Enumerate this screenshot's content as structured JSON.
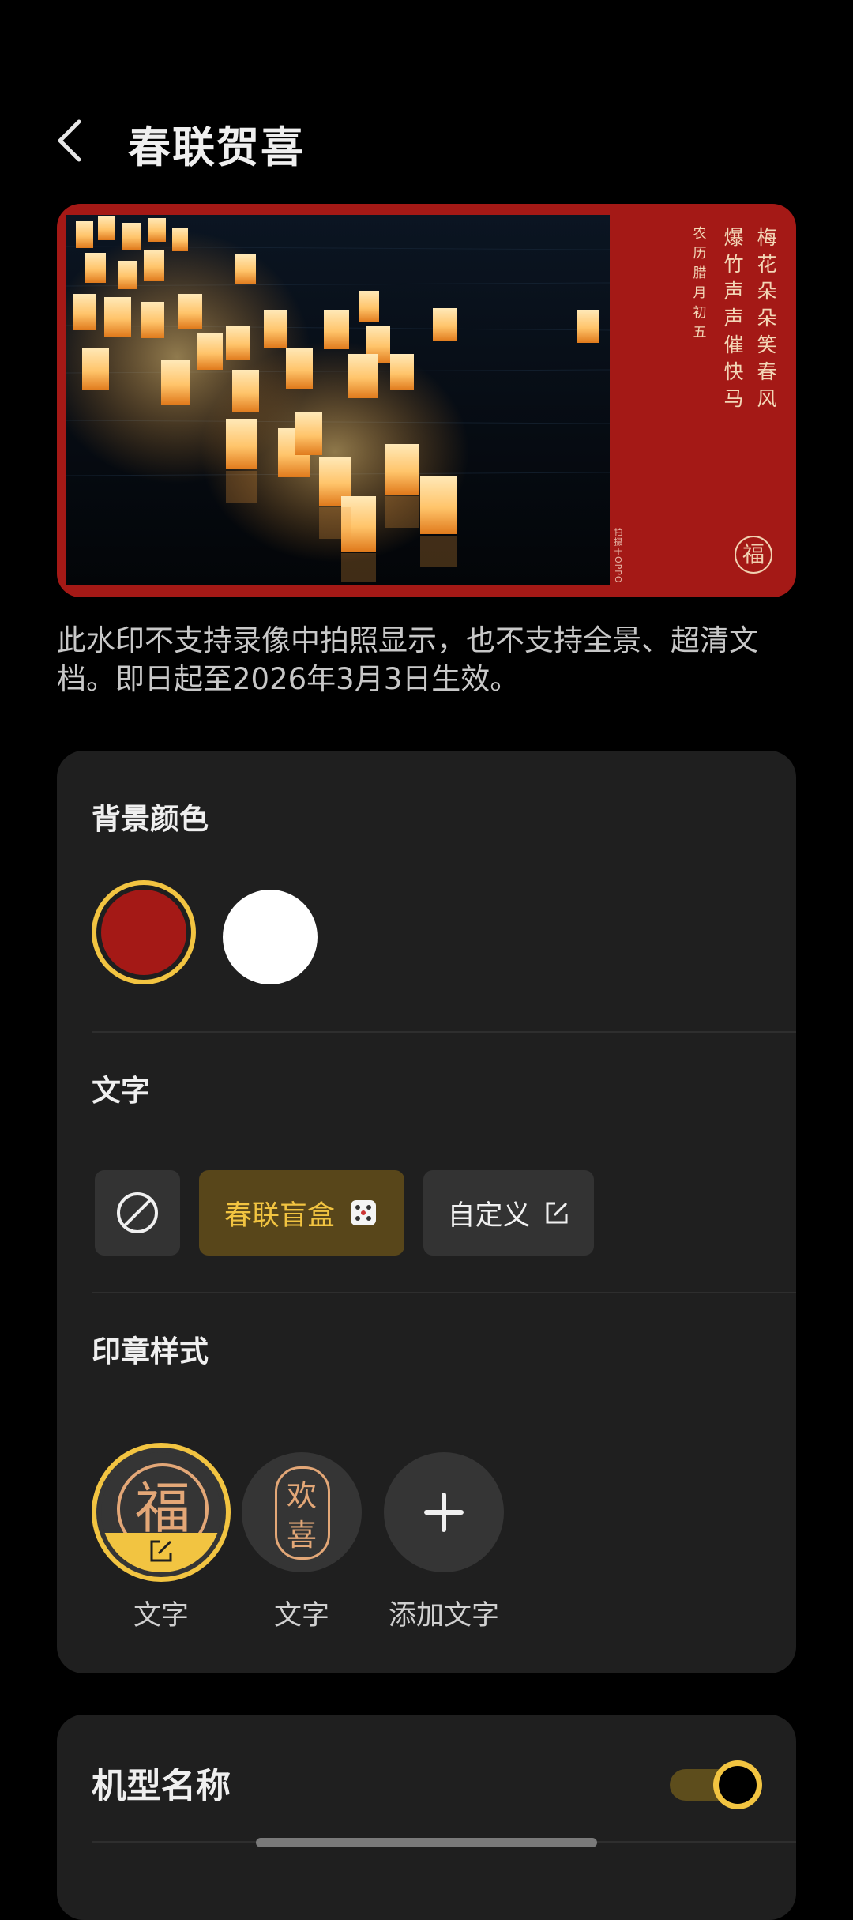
{
  "header": {
    "title": "春联贺喜",
    "back_icon": "chevron-left-icon"
  },
  "preview": {
    "couplet_right": "梅花朵朵笑春风",
    "couplet_left": "爆竹声声催快马",
    "date": "农历腊月初五",
    "mark_text": "拍摄于OPPO",
    "fu": "福"
  },
  "notice": "此水印不支持录像中拍照显示，也不支持全景、超清文档。即日起至2026年3月3日生效。",
  "background_color": {
    "title": "背景颜色",
    "options": [
      {
        "color": "#a41916",
        "selected": true
      },
      {
        "color": "#ffffff",
        "selected": false
      }
    ]
  },
  "text": {
    "title": "文字",
    "none_icon": "prohibit-icon",
    "blind_box_label": "春联盲盒",
    "blind_box_icon": "dice-icon",
    "custom_label": "自定义",
    "custom_icon": "edit-icon"
  },
  "stamp": {
    "title": "印章样式",
    "items": [
      {
        "glyph": "福",
        "label": "文字",
        "selected": true
      },
      {
        "glyph_top": "欢",
        "glyph_bottom": "喜",
        "label": "文字",
        "selected": false
      }
    ],
    "add_label": "添加文字",
    "add_icon": "plus-icon"
  },
  "model_name": {
    "title": "机型名称",
    "enabled": true
  },
  "colors": {
    "accent": "#f2c441",
    "card": "#1f1f1f",
    "red": "#a41916"
  }
}
